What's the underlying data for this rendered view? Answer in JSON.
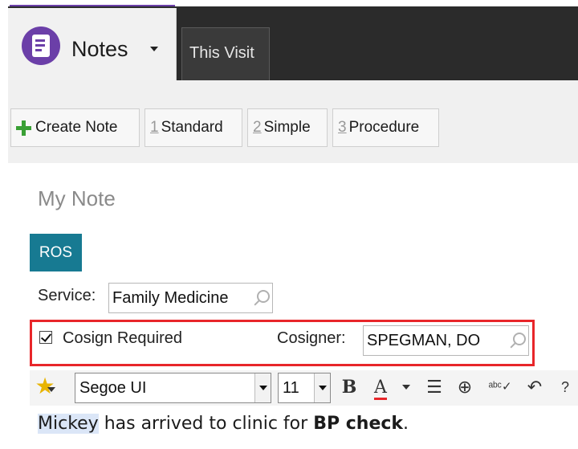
{
  "header": {
    "tab_notes_label": "Notes",
    "tab_visit_label": "This Visit"
  },
  "toolbar": {
    "create_note_label": "Create Note",
    "standard": {
      "num": "1",
      "label": "Standard"
    },
    "simple": {
      "num": "2",
      "label": "Simple"
    },
    "procedure": {
      "num": "3",
      "label": "Procedure"
    }
  },
  "note": {
    "title": "My Note",
    "section_badge": "ROS",
    "service_label": "Service:",
    "service_value": "Family Medicine",
    "cosign_label": "Cosign Required",
    "cosign_checked": true,
    "cosigner_label": "Cosigner:",
    "cosigner_value": "SPEGMAN, DO"
  },
  "editor": {
    "font_name": "Segoe UI",
    "font_size": "11",
    "bold_label": "B",
    "color_label": "A",
    "text_color": "#e8262a",
    "body": {
      "name": "Mickey",
      "middle": " has arrived to clinic for ",
      "bold": "BP check",
      "end": "."
    }
  },
  "colors": {
    "accent_purple": "#6b3fa8",
    "badge_teal": "#177a92",
    "highlight_red": "#e8262a",
    "plus_green": "#3aa035"
  }
}
